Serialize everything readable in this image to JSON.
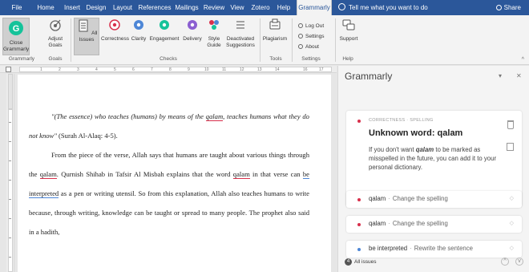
{
  "menu": {
    "tabs": [
      "File",
      "Home",
      "Insert",
      "Design",
      "Layout",
      "References",
      "Mailings",
      "Review",
      "View",
      "Zotero",
      "Help",
      "Grammarly"
    ],
    "active_tab": "Grammarly",
    "tell_me": "Tell me what you want to do",
    "share": "Share"
  },
  "ribbon": {
    "close_grammarly": "Close Grammarly",
    "adjust_goals": "Adjust Goals",
    "all_issues": "All Issues",
    "correctness": "Correctness",
    "clarity": "Clarity",
    "engagement": "Engagement",
    "delivery": "Delivery",
    "style_guide": "Style Guide",
    "deactivated_suggestions": "Deactivated Suggestions",
    "plagiarism": "Plagiarism",
    "log_out": "Log Out",
    "settings": "Settings",
    "about": "About",
    "support": "Support",
    "groups": {
      "grammarly": "Grammarly",
      "goals": "Goals",
      "checks": "Checks",
      "tools": "Tools",
      "settings": "Settings",
      "help": "Help"
    }
  },
  "ruler": {
    "ticks": [
      "1",
      "2",
      "3",
      "4",
      "5",
      "6",
      "7",
      "8",
      "9",
      "10",
      "11",
      "12",
      "13",
      "14",
      "16",
      "17"
    ]
  },
  "document": {
    "p1_quote_a": "\"(The essence) who teaches (humans) by means of the ",
    "p1_err": "qalam",
    "p1_quote_b": ", teaches humans what they do not know\"",
    "p1_ref": " (Surah Al-Alaq: 4-5).",
    "p2_a": "From the piece of the verse, Allah says that humans are taught about various things through the ",
    "p2_err1": "qalam",
    "p2_b": ". Qurnish Shihab in Tafsir Al Misbah explains that the word ",
    "p2_err2": "qalam",
    "p2_c": " in that verse can ",
    "p2_blue": "be interpreted",
    "p2_d": " as a pen or writing utensil. So from this explanation, Allah also teaches humans to write because, through writing, knowledge can be taught or spread to many people. The prophet also said in a hadith,"
  },
  "grammarly_panel": {
    "title": "Grammarly",
    "card": {
      "category": "CORRECTNESS · SPELLING",
      "heading": "Unknown word: qalam",
      "desc_a": "If you don't want ",
      "desc_word": "qalam",
      "desc_b": " to be marked as misspelled in the future, you can add it to your personal dictionary."
    },
    "rows": [
      {
        "word": "qalam",
        "action": "Change the spelling"
      },
      {
        "word": "qalam",
        "action": "Change the spelling"
      },
      {
        "word": "be interpreted",
        "action": "Rewrite the sentence"
      }
    ],
    "footer_count": "4",
    "footer_label": "All issues"
  },
  "colors": {
    "brand": "#2b579a",
    "grammarly_green": "#15c39a",
    "error_red": "#d8304c",
    "clarity_blue": "#4d86d6"
  }
}
